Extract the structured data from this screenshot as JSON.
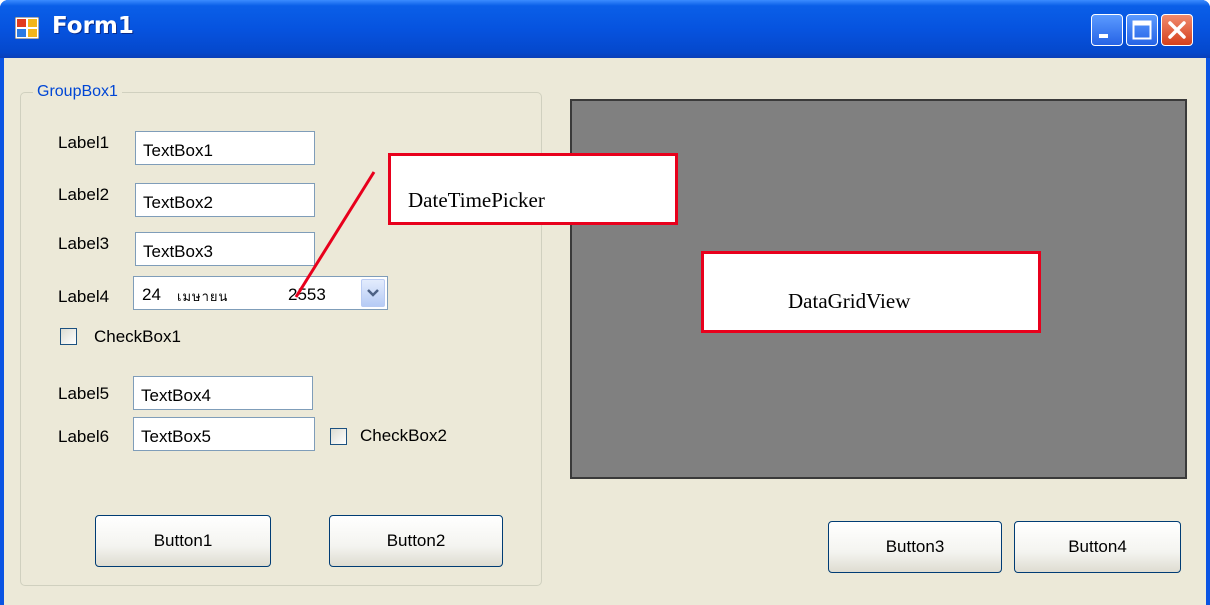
{
  "window": {
    "title": "Form1"
  },
  "groupbox": {
    "caption": "GroupBox1",
    "rows": [
      {
        "label": "Label1",
        "textbox": "TextBox1"
      },
      {
        "label": "Label2",
        "textbox": "TextBox2"
      },
      {
        "label": "Label3",
        "textbox": "TextBox3"
      }
    ],
    "date_row": {
      "label": "Label4",
      "day": "24",
      "month": "เมษายน",
      "year": "2553"
    },
    "checkbox1": {
      "label": "CheckBox1",
      "checked": false
    },
    "rows2": [
      {
        "label": "Label5",
        "textbox": "TextBox4"
      },
      {
        "label": "Label6",
        "textbox": "TextBox5"
      }
    ],
    "checkbox2": {
      "label": "CheckBox2",
      "checked": false
    },
    "button1": "Button1",
    "button2": "Button2"
  },
  "grid_buttons": {
    "button3": "Button3",
    "button4": "Button4"
  },
  "annotations": {
    "datetimepicker": "DateTimePicker",
    "datagridview": "DataGridView"
  },
  "colors": {
    "titlebar": "#0653df",
    "client": "#ece9d8",
    "grid": "#808080",
    "callout_border": "#e8001c"
  }
}
